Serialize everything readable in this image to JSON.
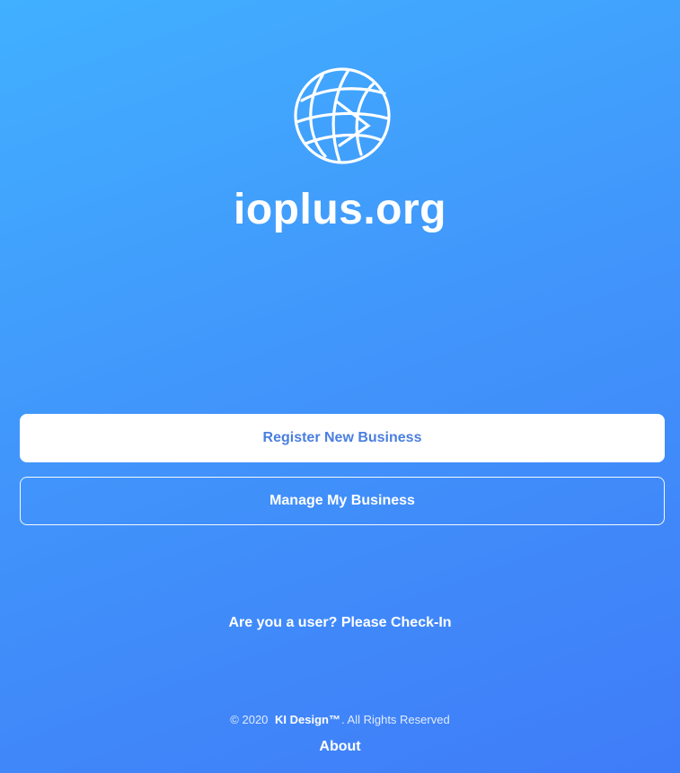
{
  "brand": {
    "logo_icon": "globe-icon",
    "title": "ioplus.org"
  },
  "actions": {
    "register_label": "Register New Business",
    "manage_label": "Manage My Business"
  },
  "checkin": {
    "label": "Are you a user? Please Check-In"
  },
  "footer": {
    "copyright": "© 2020",
    "company": "KI Design™",
    "rights": ". All Rights Reserved",
    "about_label": "About"
  },
  "colors": {
    "gradient_start": "#41b0ff",
    "gradient_end": "#3f7cf8",
    "button_text": "#4a7fe0"
  }
}
